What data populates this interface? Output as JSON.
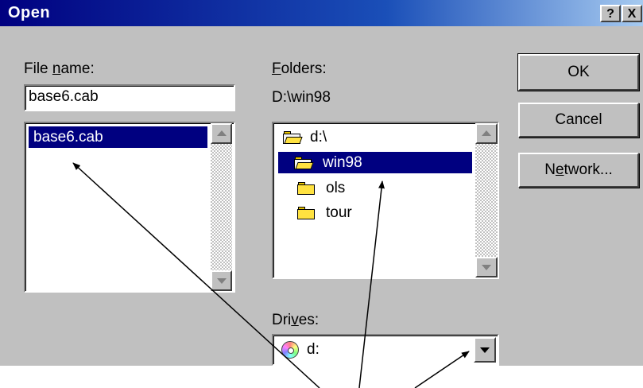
{
  "window": {
    "title": "Open",
    "help_button": "?",
    "close_button": "X"
  },
  "file_name": {
    "label_pre": "File ",
    "label_accel": "n",
    "label_post": "ame:",
    "value": "base6.cab",
    "list": [
      "base6.cab"
    ]
  },
  "folders": {
    "label_accel": "F",
    "label_post": "olders:",
    "current_path": "D:\\win98",
    "items": [
      {
        "name": "d:\\",
        "icon": "open-folder-icon"
      },
      {
        "name": "win98",
        "icon": "open-folder-icon"
      },
      {
        "name": "ols",
        "icon": "folder-icon"
      },
      {
        "name": "tour",
        "icon": "folder-icon"
      }
    ]
  },
  "drives": {
    "label_pre": "Dri",
    "label_accel": "v",
    "label_post": "es:",
    "selected": "d:",
    "icon": "cd-drive-icon"
  },
  "buttons": {
    "ok": "OK",
    "cancel": "Cancel",
    "network_pre": "N",
    "network_accel": "e",
    "network_post": "twork..."
  },
  "colors": {
    "title_start": "#000080",
    "selection": "#000080",
    "face": "#c0c0c0"
  }
}
